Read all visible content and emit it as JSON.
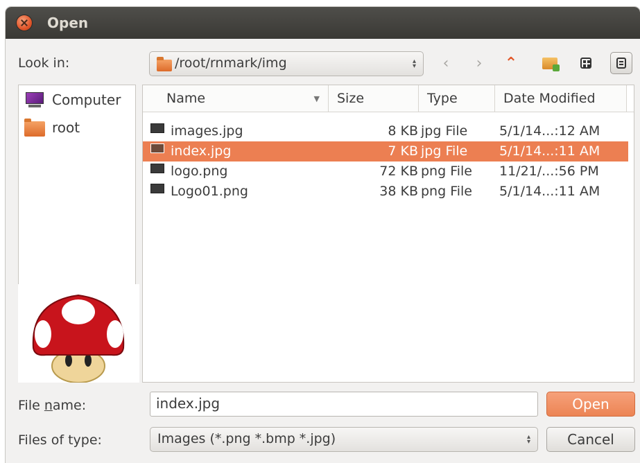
{
  "window": {
    "title": "Open"
  },
  "look_in": {
    "label": "Look in:",
    "path": "/root/rnmark/img"
  },
  "toolbar": {
    "back_icon": "chevron-left-icon",
    "forward_icon": "chevron-right-icon",
    "up_icon": "up-arrow-icon",
    "new_folder_icon": "new-folder-icon",
    "icon_view_icon": "grid-view-icon",
    "detail_view_icon": "detail-view-icon"
  },
  "places": [
    {
      "label": "Computer",
      "icon": "computer-icon"
    },
    {
      "label": "root",
      "icon": "folder-icon"
    }
  ],
  "columns": [
    "Name",
    "Size",
    "Type",
    "Date Modified"
  ],
  "files": [
    {
      "name": "images.jpg",
      "size": "8 KB",
      "type": "jpg File",
      "date": "5/1/14...:12 AM",
      "selected": false
    },
    {
      "name": "index.jpg",
      "size": "7 KB",
      "type": "jpg File",
      "date": "5/1/14...:11 AM",
      "selected": true
    },
    {
      "name": "logo.png",
      "size": "72 KB",
      "type": "png File",
      "date": "11/21/...:56 PM",
      "selected": false
    },
    {
      "name": "Logo01.png",
      "size": "38 KB",
      "type": "png File",
      "date": "5/1/14...:11 AM",
      "selected": false
    }
  ],
  "file_name": {
    "label": "File name:",
    "value": "index.jpg"
  },
  "file_type": {
    "label": "Files of type:",
    "value": "Images (*.png *.bmp *.jpg)"
  },
  "buttons": {
    "open": "Open",
    "cancel": "Cancel"
  },
  "colors": {
    "selection": "#ec7f52",
    "accent": "#ec8454",
    "titlebar": "#3c3b37"
  }
}
